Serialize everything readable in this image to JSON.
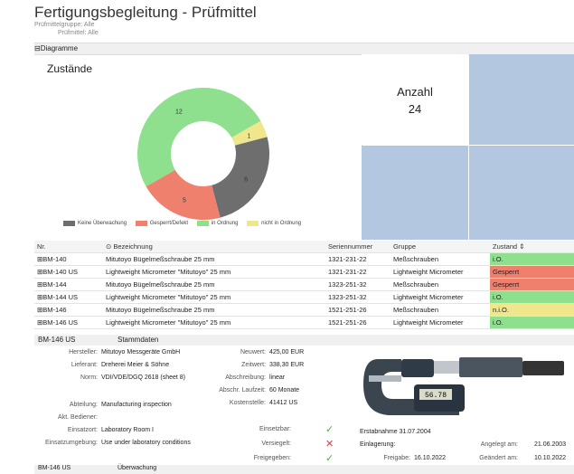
{
  "title": "Fertigungsbegleitung - Prüfmittel",
  "subtitle1": "Prüfmittelgruppe: Alle",
  "subtitle2": "Prüfmittel: Alle",
  "section_diagram": "⊟Diagramme",
  "chart_data": {
    "type": "pie",
    "title": "Zustände",
    "categories": [
      "Keine Überwachung",
      "Gesperrt/Defekt",
      "in Ordnung",
      "nicht in Ordnung"
    ],
    "values": [
      6,
      5,
      12,
      1
    ],
    "colors": [
      "#6e6e6e",
      "#f0806e",
      "#8ee08e",
      "#f0e68c"
    ]
  },
  "legend": [
    "Keine Überwachung",
    "Gesperrt/Defekt",
    "in Ordnung",
    "nicht in Ordnung"
  ],
  "anzahl": {
    "label": "Anzahl",
    "value": "24"
  },
  "table": {
    "headers": [
      "Nr.",
      "Bezeichnung",
      "Seriennummer",
      "Gruppe",
      "Zustand"
    ],
    "rows": [
      [
        "⊞BM-140",
        "Mitutoyo Bügelmeßschraube 25 mm",
        "1321-231-22",
        "Meßschrauben",
        "i.O."
      ],
      [
        "⊞BM-140 US",
        "Lightweight Micrometer \"Mitutoyo\" 25 mm",
        "1321-231-22",
        "Lightweight Micrometer",
        "Gesperrt"
      ],
      [
        "⊞BM-144",
        "Mitutoyo Bügelmeßschraube 25 mm",
        "1323-251-32",
        "Meßschrauben",
        "Gesperrt"
      ],
      [
        "⊞BM-144 US",
        "Lightweight Micrometer \"Mitutoyo\" 25 mm",
        "1323-251-32",
        "Lightweight Micrometer",
        "i.O."
      ],
      [
        "⊞BM-146",
        "Mitutoyo Bügelmeßschraube 25 mm",
        "1521-251-26",
        "Meßschrauben",
        "n.i.O."
      ],
      [
        "⊞BM-146 US",
        "Lightweight Micrometer \"Mitutoyo\" 25 mm",
        "1521-251-26",
        "Lightweight Micrometer",
        "i.O."
      ]
    ],
    "status_colors": {
      "i.O.": "#8ee08e",
      "Gesperrt": "#f0806e",
      "n.i.O.": "#f0e68c"
    }
  },
  "detail": {
    "tab_id": "BM-146 US",
    "tab_label": "Stammdaten",
    "fields": {
      "hersteller_l": "Hersteller:",
      "hersteller": "Mitutoyo Messgeräte GmbH",
      "lieferant_l": "Lieferant:",
      "lieferant": "Dreherei Meier & Söhne",
      "norm_l": "Norm:",
      "norm": "VDI/VDE/DGQ 2618 (sheet 8)",
      "abteilung_l": "Abteilung:",
      "abteilung": "Manufacturing inspection",
      "bediener_l": "Akt. Bediener:",
      "einsatzort_l": "Einsatzort:",
      "einsatzort": "Laboratory Room I",
      "umgebung_l": "Einsatzumgebung:",
      "umgebung": "Use under laboratory conditions",
      "neuwert_l": "Neuwert:",
      "neuwert": "425,00 EUR",
      "zeitwert_l": "Zeitwert:",
      "zeitwert": "338,30 EUR",
      "abschreibung_l": "Abschreibung:",
      "abschreibung": "linear",
      "laufzeit_l": "Abschr. Laufzeit:",
      "laufzeit": "60 Monate",
      "kostenstelle_l": "Kostenstelle:",
      "kostenstelle": "41412 US",
      "einsetzbar_l": "Einsetzbar:",
      "versiegelt_l": "Versiegelt:",
      "freigegeben_l": "Freigegeben:",
      "erstabnahme": "Erstabnahme 31.07.2004",
      "einlagerung": "Einlagerung:",
      "freigabe_l": "Freigabe:",
      "freigabe": "16.10.2022",
      "angelegt_l": "Angelegt am:",
      "angelegt": "21.06.2003",
      "geaendert_l": "Geändert am:",
      "geaendert": "10.10.2022",
      "lcd": "56.78"
    }
  },
  "footer": {
    "id": "BM-146 US",
    "label": "Überwachung"
  }
}
